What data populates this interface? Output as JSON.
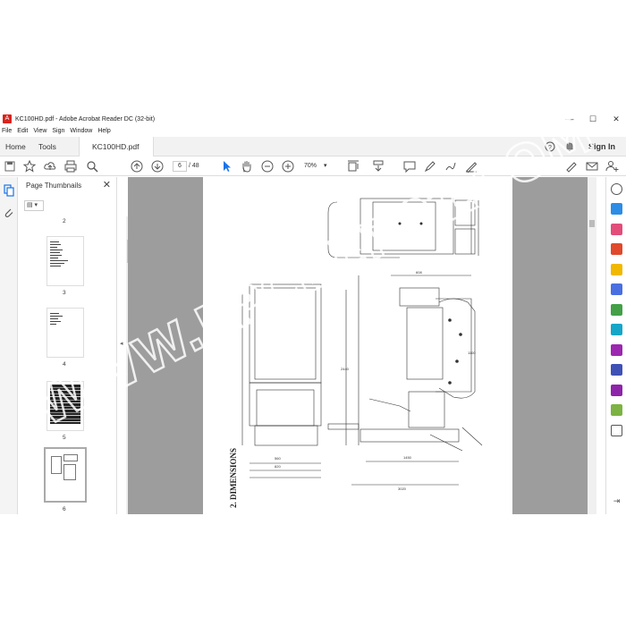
{
  "window": {
    "title": "KC100HD.pdf - Adobe Acrobat Reader DC (32-bit)",
    "minimize": "—",
    "maximize": "☐",
    "close": "✕"
  },
  "menu": [
    "File",
    "Edit",
    "View",
    "Sign",
    "Window",
    "Help"
  ],
  "tabs": {
    "home": "Home",
    "tools": "Tools",
    "document": "KC100HD.pdf"
  },
  "header": {
    "sign_in": "Sign In"
  },
  "toolbar": {
    "current_page": "6",
    "page_separator": "/",
    "total_pages": "48",
    "zoom": "70%"
  },
  "panel": {
    "title": "Page Thumbnails",
    "close": "✕",
    "options": "▤ ▾",
    "page_numbers": [
      "2",
      "3",
      "4",
      "5",
      "6"
    ]
  },
  "drawing": {
    "heading": "2. DIMENSIONS",
    "dims": [
      "560",
      "820",
      "1450",
      "3020",
      "2440",
      "1100",
      "608",
      "180",
      "620",
      "680",
      "830",
      "2120",
      "1470",
      "720",
      "600",
      "3412",
      "1285"
    ]
  },
  "watermark": "WWW.EPCDEPOT.COM",
  "colors": {
    "accent": "#1a73e8",
    "brand": "#d9231d",
    "page_bg": "#9d9d9d"
  }
}
